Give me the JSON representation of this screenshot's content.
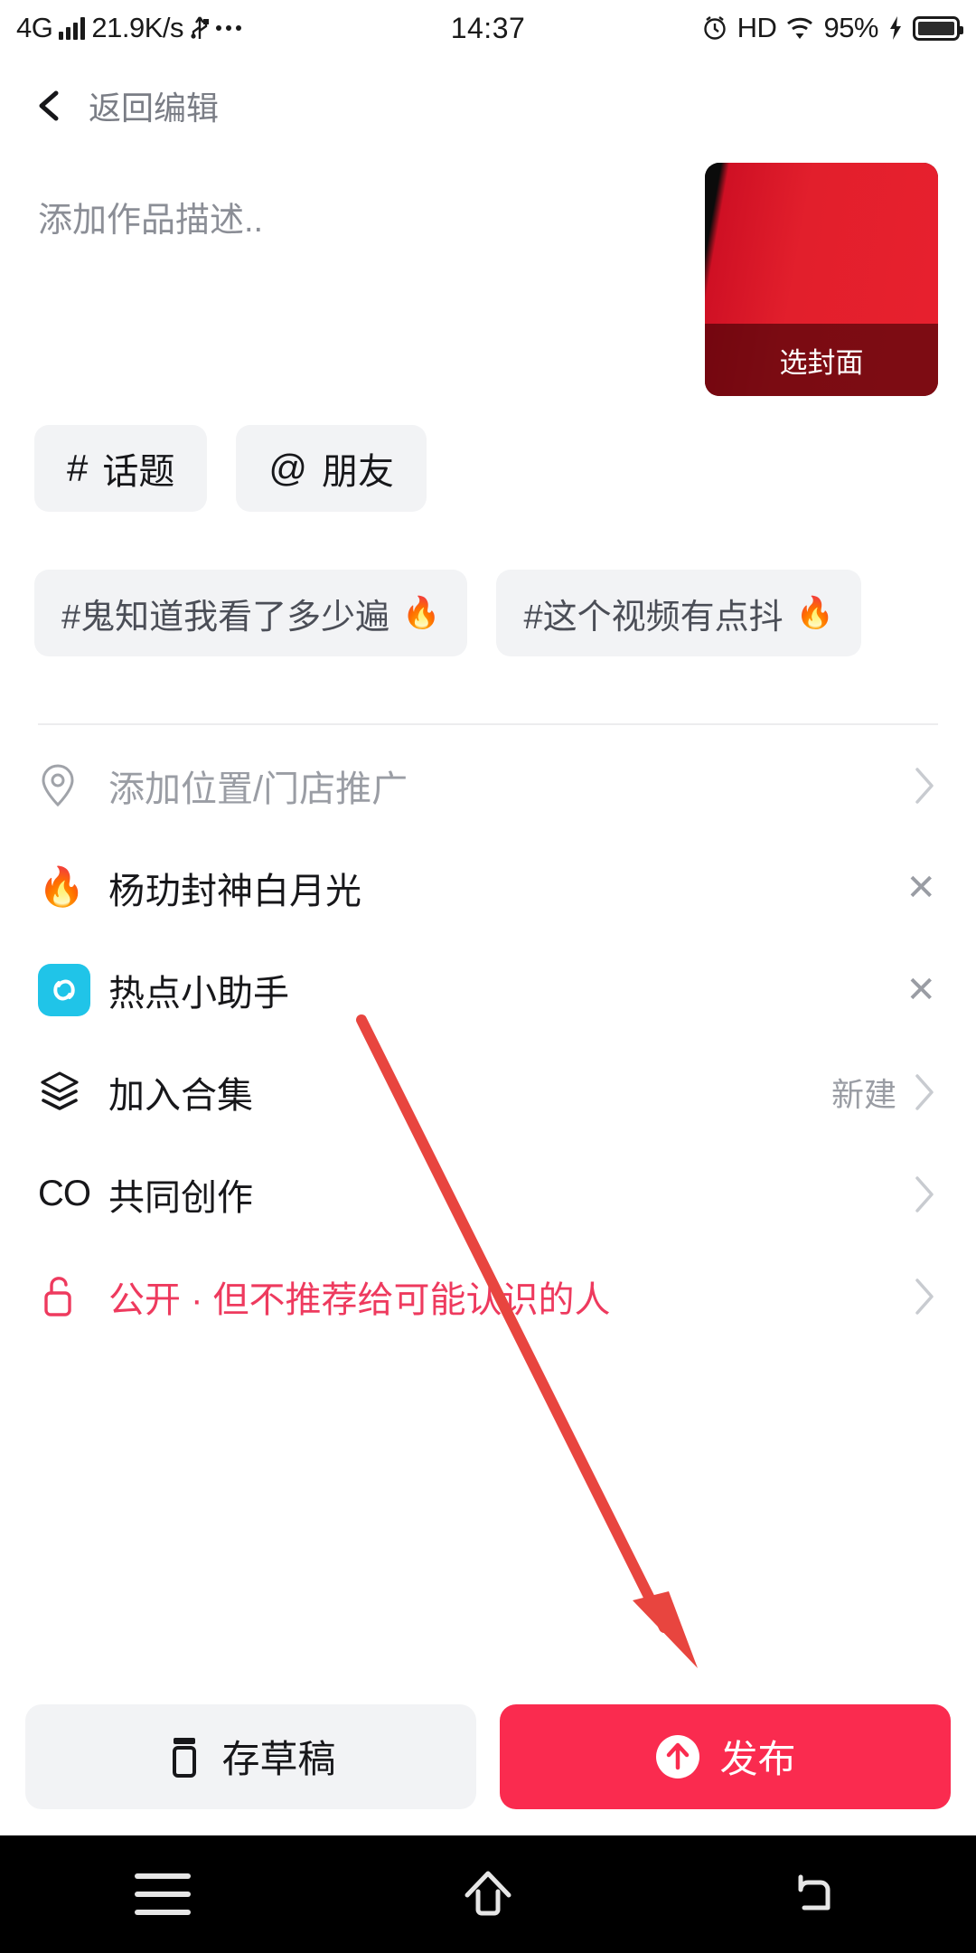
{
  "status_bar": {
    "network_type": "4G",
    "speed": "21.9K/s",
    "usb_icon": "usb-icon",
    "more_icon": "more-dots-icon",
    "time": "14:37",
    "alarm_icon": "alarm-icon",
    "hd": "HD",
    "wifi_icon": "wifi-icon",
    "battery_percent": "95%",
    "charging_icon": "charging-bolt-icon"
  },
  "top_bar": {
    "back_icon": "back-chevron-icon",
    "title": "返回编辑"
  },
  "description": {
    "placeholder": "添加作品描述..",
    "value": ""
  },
  "cover": {
    "label": "选封面",
    "color": "#e2202d"
  },
  "pills": [
    {
      "symbol": "#",
      "label": "话题",
      "icon": "hash-icon"
    },
    {
      "symbol": "@",
      "label": "朋友",
      "icon": "at-icon"
    }
  ],
  "hashtag_chips": [
    {
      "text": "#鬼知道我看了多少遍",
      "flame": "🔥"
    },
    {
      "text": "#这个视频有点抖",
      "flame": "🔥"
    }
  ],
  "rows": [
    {
      "icon": "location-pin-icon",
      "label": "添加位置/门店推广",
      "value": "",
      "trailing": "chevron"
    },
    {
      "icon": "flame-emoji-icon",
      "label": "杨玏封神白月光",
      "value": "",
      "trailing": "close"
    },
    {
      "icon": "hot-assistant-app-icon",
      "label": "热点小助手",
      "value": "",
      "trailing": "close"
    },
    {
      "icon": "layers-icon",
      "label": "加入合集",
      "value": "新建",
      "trailing": "chevron"
    },
    {
      "icon": "co-create-icon",
      "label": "共同创作",
      "value": "",
      "trailing": "chevron"
    },
    {
      "icon": "unlock-icon",
      "label": "公开 · 但不推荐给可能认识的人",
      "value": "",
      "trailing": "chevron"
    }
  ],
  "action_bar": {
    "draft_label": "存草稿",
    "draft_icon": "draft-box-icon",
    "publish_label": "发布",
    "publish_icon": "upload-arrow-icon",
    "publish_color": "#fa2b4f"
  },
  "nav_bar": {
    "recents_icon": "menu-icon",
    "home_icon": "home-icon",
    "back_icon": "back-arrow-icon"
  },
  "annotation": {
    "arrow_color": "#e8453f",
    "points_to": "发布"
  }
}
